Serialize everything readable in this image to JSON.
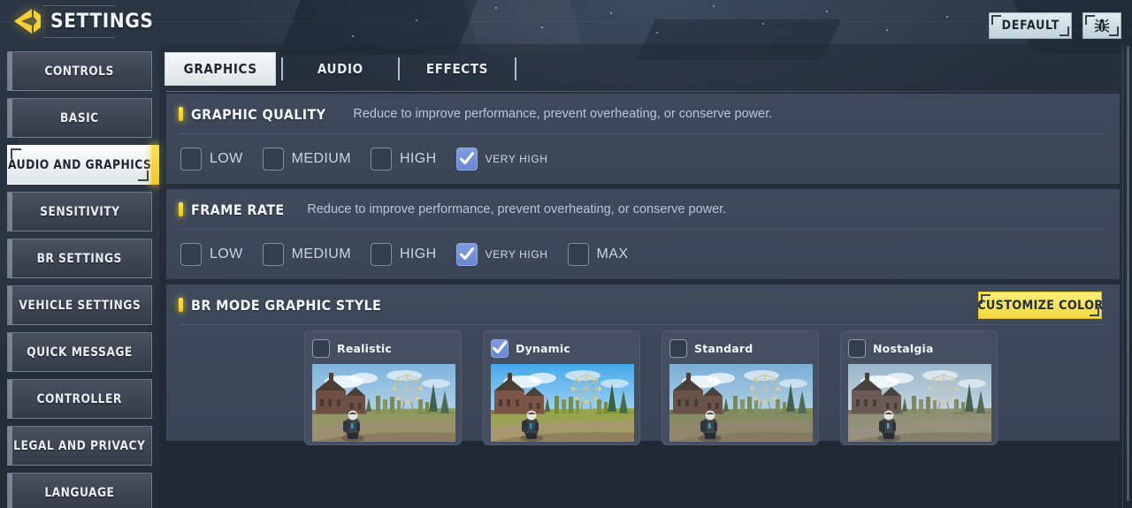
{
  "header": {
    "back_icon": "back-arrow-icon",
    "title": "SETTINGS",
    "default_label": "DEFAULT",
    "bug_icon": "bug-icon"
  },
  "sidebar": {
    "items": [
      {
        "label": "CONTROLS",
        "active": false
      },
      {
        "label": "BASIC",
        "active": false
      },
      {
        "label": "AUDIO AND GRAPHICS",
        "active": true
      },
      {
        "label": "SENSITIVITY",
        "active": false
      },
      {
        "label": "BR SETTINGS",
        "active": false
      },
      {
        "label": "VEHICLE SETTINGS",
        "active": false
      },
      {
        "label": "QUICK MESSAGE",
        "active": false
      },
      {
        "label": "CONTROLLER",
        "active": false
      },
      {
        "label": "LEGAL AND PRIVACY",
        "active": false
      },
      {
        "label": "LANGUAGE",
        "active": false
      }
    ]
  },
  "tabs": [
    {
      "label": "GRAPHICS",
      "active": true
    },
    {
      "label": "AUDIO",
      "active": false
    },
    {
      "label": "EFFECTS",
      "active": false
    }
  ],
  "sections": {
    "graphic_quality": {
      "title": "GRAPHIC QUALITY",
      "description": "Reduce to improve performance, prevent overheating, or conserve power.",
      "options": [
        {
          "label": "LOW",
          "checked": false
        },
        {
          "label": "MEDIUM",
          "checked": false
        },
        {
          "label": "HIGH",
          "checked": false
        },
        {
          "label": "VERY HIGH",
          "checked": true
        }
      ]
    },
    "frame_rate": {
      "title": "FRAME RATE",
      "description": "Reduce to improve performance, prevent overheating, or conserve power.",
      "options": [
        {
          "label": "LOW",
          "checked": false
        },
        {
          "label": "MEDIUM",
          "checked": false
        },
        {
          "label": "HIGH",
          "checked": false
        },
        {
          "label": "VERY HIGH",
          "checked": true
        },
        {
          "label": "MAX",
          "checked": false
        }
      ]
    },
    "br_mode_graphic_style": {
      "title": "BR MODE GRAPHIC STYLE",
      "customize_color_label": "CUSTOMIZE COLOR",
      "styles": [
        {
          "label": "Realistic",
          "checked": false
        },
        {
          "label": "Dynamic",
          "checked": true
        },
        {
          "label": "Standard",
          "checked": false
        },
        {
          "label": "Nostalgia",
          "checked": false
        }
      ]
    }
  },
  "colors": {
    "accent_yellow": "#f5d42a",
    "checkbox_blue": "#6a88cf",
    "panel_bg": "#3c4858",
    "sidebar_item": "#3e4653",
    "text_light": "#e8edf2"
  }
}
